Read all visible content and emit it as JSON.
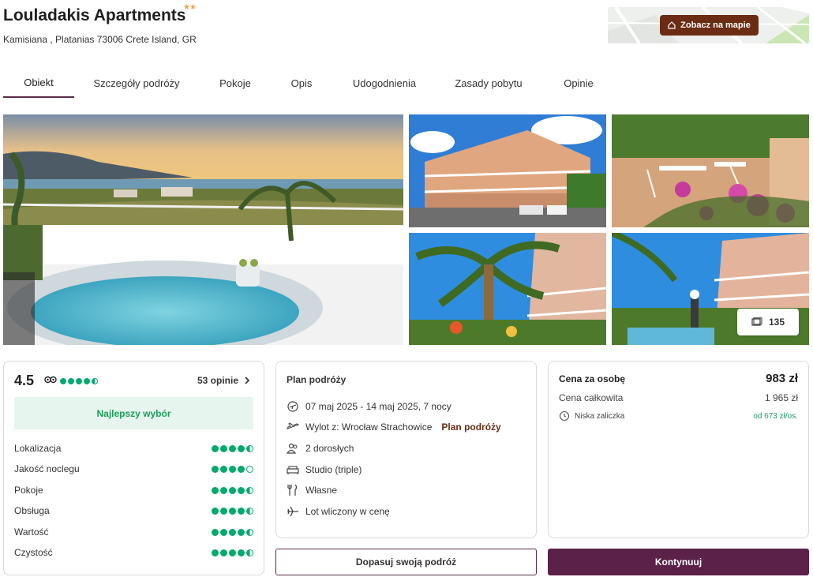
{
  "hotel": {
    "name": "Louladakis Apartments",
    "stars": "★★",
    "address": "Kamisiana , Platanias 73006 Crete Island, GR"
  },
  "map": {
    "button_label": "Zobacz na mapie"
  },
  "tabs": [
    {
      "label": "Obiekt",
      "active": true
    },
    {
      "label": "Szczegóły podróży"
    },
    {
      "label": "Pokoje"
    },
    {
      "label": "Opis"
    },
    {
      "label": "Udogodnienia"
    },
    {
      "label": "Zasady pobytu"
    },
    {
      "label": "Opinie"
    }
  ],
  "gallery": {
    "photo_count": "135"
  },
  "rating": {
    "score": "4.5",
    "tripadvisor_dots": 4.5,
    "reviews_label": "53 opinie",
    "badge": "Najlepszy wybór",
    "categories": [
      {
        "name": "Lokalizacja",
        "dots": 4.5
      },
      {
        "name": "Jakość noclegu",
        "dots": 4
      },
      {
        "name": "Pokoje",
        "dots": 4.5
      },
      {
        "name": "Obsługa",
        "dots": 4.5
      },
      {
        "name": "Wartość",
        "dots": 4.5
      },
      {
        "name": "Czystość",
        "dots": 4.5
      }
    ]
  },
  "plan": {
    "title": "Plan podróży",
    "dates": "07 maj 2025 - 14 maj 2025, 7 nocy",
    "departure": "Wylot z: Wrocław Strachowice",
    "departure_link": "Plan podróży",
    "guests": "2 dorosłych",
    "room": "Studio (triple)",
    "board": "Własne",
    "flight": "Lot wliczony w cenę"
  },
  "price": {
    "per_person_label": "Cena za osobę",
    "per_person_value": "983 zł",
    "total_label": "Cena całkowita",
    "total_value": "1 965 zł",
    "deposit_label": "Niska zaliczka",
    "deposit_value": "od 673 zł/os."
  },
  "buttons": {
    "customize": "Dopasuj swoją podróż",
    "continue": "Kontynuuj"
  },
  "colors": {
    "brand_dark": "#5b2148",
    "map_button": "#6a2c12",
    "tripadvisor_green": "#00aa6c",
    "badge_green": "#1b9e5a"
  }
}
